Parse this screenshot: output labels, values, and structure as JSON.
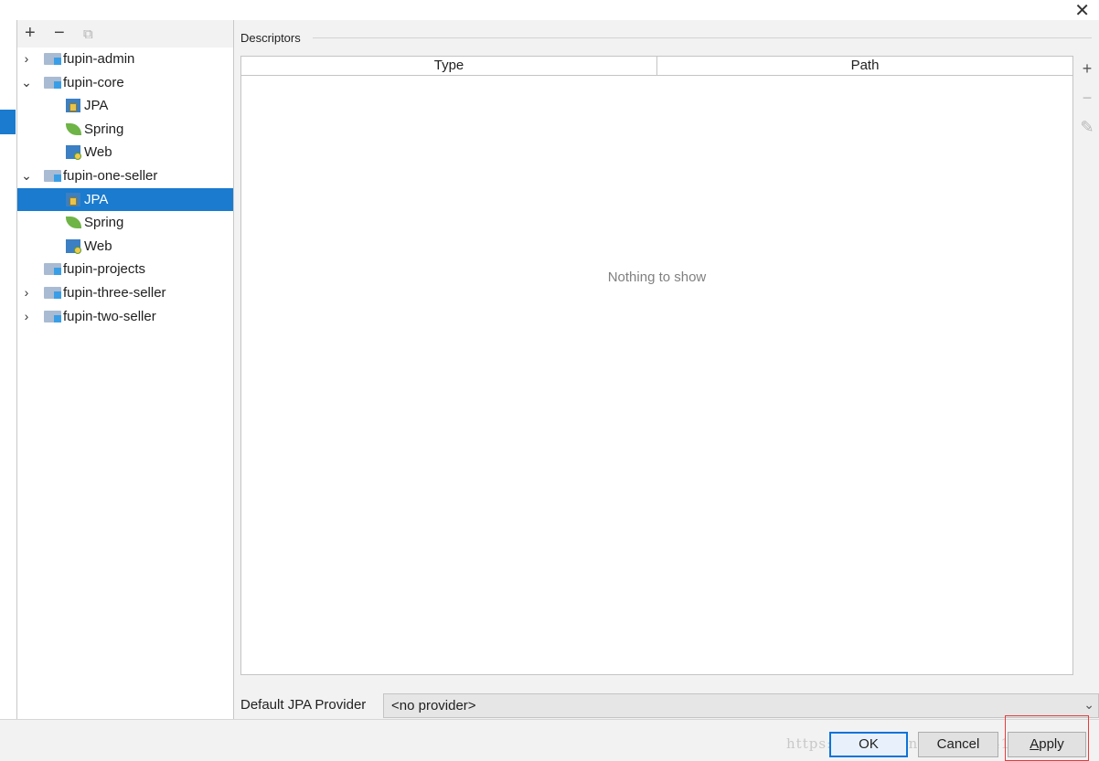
{
  "window": {
    "close_glyph": "✕"
  },
  "tree_toolbar": {
    "add_glyph": "+",
    "remove_glyph": "−",
    "copy_glyph": "⧉"
  },
  "tree": [
    {
      "label": "fupin-admin",
      "kind": "module",
      "arrow": "›",
      "expanded": false,
      "selected": false
    },
    {
      "label": "fupin-core",
      "kind": "module",
      "arrow": "⌄",
      "expanded": true,
      "selected": false
    },
    {
      "label": "JPA",
      "kind": "jpa",
      "selected": false
    },
    {
      "label": "Spring",
      "kind": "spring",
      "selected": false
    },
    {
      "label": "Web",
      "kind": "web",
      "selected": false
    },
    {
      "label": "fupin-one-seller",
      "kind": "module",
      "arrow": "⌄",
      "expanded": true,
      "selected": false
    },
    {
      "label": "JPA",
      "kind": "jpa",
      "selected": true
    },
    {
      "label": "Spring",
      "kind": "spring",
      "selected": false
    },
    {
      "label": "Web",
      "kind": "web",
      "selected": false
    },
    {
      "label": "fupin-projects",
      "kind": "module",
      "arrow": "",
      "expanded": false,
      "selected": false
    },
    {
      "label": "fupin-three-seller",
      "kind": "module",
      "arrow": "›",
      "expanded": false,
      "selected": false
    },
    {
      "label": "fupin-two-seller",
      "kind": "module",
      "arrow": "›",
      "expanded": false,
      "selected": false
    }
  ],
  "descriptors": {
    "group_title": "Descriptors",
    "columns": [
      "Type",
      "Path"
    ],
    "empty_text": "Nothing to show",
    "side_tools": {
      "add": "+",
      "remove": "−",
      "edit": "✎"
    }
  },
  "provider": {
    "label": "Default JPA Provider",
    "value": "<no provider>",
    "chevron": "⌄"
  },
  "buttons": {
    "ok": "OK",
    "cancel": "Cancel",
    "apply_mnemonic": "A",
    "apply_rest": "pply"
  },
  "watermark": "https://blog.csdn.net/qq_34101023",
  "colors": {
    "selection": "#1a7bcf",
    "highlight_box": "#e53b3b",
    "ok_border": "#0d73d7"
  }
}
